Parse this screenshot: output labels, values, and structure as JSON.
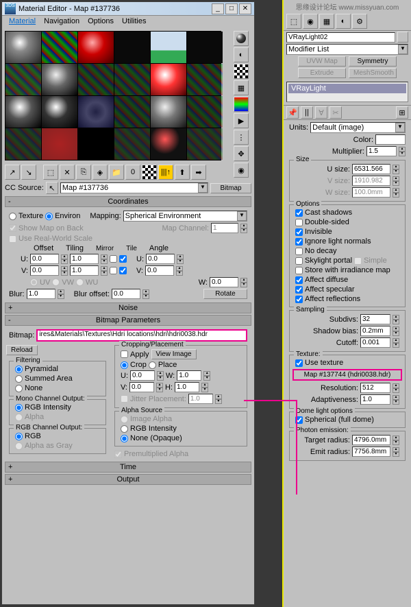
{
  "window": {
    "title": "Material Editor - Map #137736"
  },
  "menu": {
    "material": "Material",
    "navigation": "Navigation",
    "options": "Options",
    "utilities": "Utilities"
  },
  "cc": {
    "label": "CC Source:",
    "map": "Map #137736",
    "bitmap": "Bitmap"
  },
  "coords": {
    "title": "Coordinates",
    "texture": "Texture",
    "environ": "Environ",
    "mapping": "Mapping:",
    "mapval": "Spherical Environment",
    "showmap": "Show Map on Back",
    "mapch": "Map Channel:",
    "mapchv": "1",
    "realworld": "Use Real-World Scale",
    "offset": "Offset",
    "tiling": "Tiling",
    "mirror": "Mirror",
    "tile": "Tile",
    "angle": "Angle",
    "u": "U:",
    "v": "V:",
    "w": "W:",
    "blur": "Blur:",
    "bluroff": "Blur offset:",
    "rotate": "Rotate",
    "uv": "UV",
    "vw": "VW",
    "wu": "WU",
    "u_off": "0.0",
    "u_til": "1.0",
    "u_ang": "0.0",
    "v_off": "0.0",
    "v_til": "1.0",
    "v_ang": "0.0",
    "w_ang": "0.0",
    "blurv": "1.0",
    "bloffv": "0.0"
  },
  "noise": {
    "title": "Noise"
  },
  "bmp": {
    "title": "Bitmap Parameters",
    "bitmap": "Bitmap:",
    "path": "ires&Materials\\Textures\\Hdri locations\\hdri\\hdri0038.hdr",
    "reload": "Reload",
    "cropping": "Cropping/Placement",
    "apply": "Apply",
    "viewimg": "View Image",
    "crop": "Crop",
    "place": "Place",
    "u": "U:",
    "v": "V:",
    "w": "W:",
    "h": "H:",
    "jitter": "Jitter Placement:",
    "uv": "0.0",
    "vv": "0.0",
    "wv": "1.0",
    "hv": "1.0",
    "jv": "1.0",
    "filtering": "Filtering",
    "pyr": "Pyramidal",
    "sum": "Summed Area",
    "none": "None",
    "mono": "Mono Channel Output:",
    "rgbint": "RGB Intensity",
    "alpha": "Alpha",
    "rgbout": "RGB Channel Output:",
    "rgb": "RGB",
    "alphagray": "Alpha as Gray",
    "alphasrc": "Alpha Source",
    "imgalpha": "Image Alpha",
    "noneop": "None (Opaque)",
    "premult": "Premultiplied Alpha"
  },
  "time": {
    "title": "Time"
  },
  "output": {
    "title": "Output"
  },
  "right": {
    "watermark": "思缘设计论坛 www.missyuan.com",
    "name": "VRayLight02",
    "modlist": "Modifier List",
    "uvw": "UVW Map",
    "sym": "Symmetry",
    "extrude": "Extrude",
    "mesh": "MeshSmooth",
    "vray": "VRayLight",
    "units": "Units:",
    "unitsv": "Default (image)",
    "color": "Color:",
    "mult": "Multiplier:",
    "multv": "1.5",
    "size": "Size",
    "usize": "U size:",
    "usizev": "6531.566",
    "vsize": "V size:",
    "vsizev": "1910.982",
    "wsize": "W size:",
    "wsizev": "100.0mm",
    "options": "Options",
    "cast": "Cast shadows",
    "double": "Double-sided",
    "invis": "Invisible",
    "ignore": "Ignore light normals",
    "nodecay": "No decay",
    "skylight": "Skylight portal",
    "simple": "Simple",
    "store": "Store with irradiance map",
    "diffuse": "Affect diffuse",
    "specular": "Affect specular",
    "reflect": "Affect reflections",
    "sampling": "Sampling",
    "subdivs": "Subdivs:",
    "subdivsv": "32",
    "shadowbias": "Shadow bias:",
    "shadowbiasv": "0.2mm",
    "cutoff": "Cutoff:",
    "cutoffv": "0.001",
    "texture": "Texture:",
    "usetex": "Use texture",
    "mapbtn": "Map #137744 (hdri0038.hdr)",
    "resolution": "Resolution:",
    "resolutionv": "512",
    "adaptive": "Adaptiveness:",
    "adaptivev": "1.0",
    "dome": "Dome light options",
    "spherical": "Spherical (full dome)",
    "photon": "Photon emission:",
    "target": "Target radius:",
    "targetv": "4796.0mm",
    "emit": "Emit radius:",
    "emitv": "7756.8mm"
  }
}
